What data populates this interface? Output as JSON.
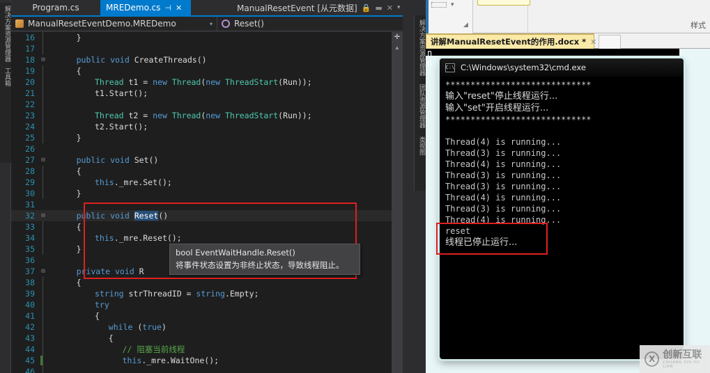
{
  "vs": {
    "dock_left_tabs": [
      "解决方案资源管理器",
      "工具箱"
    ],
    "dock_right_tabs": [
      "解决方案资源管理器",
      "团队资源管理器",
      "类视图"
    ],
    "tabs": [
      {
        "label": "Program.cs",
        "state": "inactive"
      },
      {
        "label": "MREDemo.cs",
        "state": "active",
        "pin": "⊣",
        "close": "✕"
      },
      {
        "label": "ManualResetEvent [从元数据]",
        "state": "metadata",
        "lock": "🔒",
        "close": "✕",
        "chevron": "▾"
      }
    ],
    "navbar": {
      "type_name": "ManualResetEventDemo.MREDemo",
      "member_name": "Reset()",
      "chevron": "▾"
    },
    "tooltip": {
      "signature": "bool EventWaitHandle.Reset()",
      "description": "将事件状态设置为非终止状态，导致线程阻止。"
    },
    "scrollbar": {
      "split_icon": "✛",
      "up_arrow": "▲"
    },
    "code_lines": [
      {
        "n": "16",
        "fold": "",
        "rail": true,
        "indent": 6,
        "segs": [
          {
            "t": "}",
            "c": "w"
          }
        ]
      },
      {
        "n": "17",
        "fold": "",
        "rail": true,
        "indent": 0,
        "segs": []
      },
      {
        "n": "18",
        "fold": "⊟",
        "rail": false,
        "indent": 6,
        "segs": [
          {
            "t": "public ",
            "c": "k"
          },
          {
            "t": "void ",
            "c": "k"
          },
          {
            "t": "CreateThreads()",
            "c": "w"
          }
        ]
      },
      {
        "n": "19",
        "fold": "",
        "rail": true,
        "indent": 6,
        "segs": [
          {
            "t": "{",
            "c": "w"
          }
        ]
      },
      {
        "n": "20",
        "fold": "",
        "rail": true,
        "indent": 10,
        "segs": [
          {
            "t": "Thread",
            "c": "t"
          },
          {
            "t": " t1 = ",
            "c": "w"
          },
          {
            "t": "new ",
            "c": "k"
          },
          {
            "t": "Thread",
            "c": "t"
          },
          {
            "t": "(",
            "c": "w"
          },
          {
            "t": "new ",
            "c": "k"
          },
          {
            "t": "ThreadStart",
            "c": "t"
          },
          {
            "t": "(Run));",
            "c": "w"
          }
        ]
      },
      {
        "n": "21",
        "fold": "",
        "rail": true,
        "indent": 10,
        "segs": [
          {
            "t": "t1.Start();",
            "c": "w"
          }
        ]
      },
      {
        "n": "22",
        "fold": "",
        "rail": true,
        "indent": 0,
        "segs": []
      },
      {
        "n": "23",
        "fold": "",
        "rail": true,
        "indent": 10,
        "segs": [
          {
            "t": "Thread",
            "c": "t"
          },
          {
            "t": " t2 = ",
            "c": "w"
          },
          {
            "t": "new ",
            "c": "k"
          },
          {
            "t": "Thread",
            "c": "t"
          },
          {
            "t": "(",
            "c": "w"
          },
          {
            "t": "new ",
            "c": "k"
          },
          {
            "t": "ThreadStart",
            "c": "t"
          },
          {
            "t": "(Run));",
            "c": "w"
          }
        ]
      },
      {
        "n": "24",
        "fold": "",
        "rail": true,
        "indent": 10,
        "segs": [
          {
            "t": "t2.Start();",
            "c": "w"
          }
        ]
      },
      {
        "n": "25",
        "fold": "",
        "rail": true,
        "indent": 6,
        "segs": [
          {
            "t": "}",
            "c": "w"
          }
        ]
      },
      {
        "n": "26",
        "fold": "",
        "rail": false,
        "indent": 0,
        "segs": []
      },
      {
        "n": "27",
        "fold": "⊟",
        "rail": false,
        "indent": 6,
        "segs": [
          {
            "t": "public ",
            "c": "k"
          },
          {
            "t": "void ",
            "c": "k"
          },
          {
            "t": "Set()",
            "c": "w"
          }
        ]
      },
      {
        "n": "28",
        "fold": "",
        "rail": true,
        "indent": 6,
        "segs": [
          {
            "t": "{",
            "c": "w"
          }
        ]
      },
      {
        "n": "29",
        "fold": "",
        "rail": true,
        "indent": 10,
        "segs": [
          {
            "t": "this",
            "c": "k"
          },
          {
            "t": "._mre.Set();",
            "c": "w"
          }
        ]
      },
      {
        "n": "30",
        "fold": "",
        "rail": true,
        "indent": 6,
        "segs": [
          {
            "t": "}",
            "c": "w"
          }
        ]
      },
      {
        "n": "31",
        "fold": "",
        "rail": false,
        "indent": 0,
        "segs": []
      },
      {
        "n": "32",
        "fold": "⊟",
        "rail": false,
        "indent": 6,
        "cur": true,
        "segs": [
          {
            "t": "public ",
            "c": "k"
          },
          {
            "t": "void ",
            "c": "k"
          },
          {
            "t": "Reset",
            "c": "sel"
          },
          {
            "t": "()",
            "c": "w"
          }
        ]
      },
      {
        "n": "33",
        "fold": "",
        "rail": true,
        "indent": 6,
        "segs": [
          {
            "t": "{",
            "c": "w"
          }
        ]
      },
      {
        "n": "34",
        "fold": "",
        "rail": true,
        "indent": 10,
        "segs": [
          {
            "t": "this",
            "c": "k"
          },
          {
            "t": "._mre.Reset();",
            "c": "w"
          }
        ]
      },
      {
        "n": "35",
        "fold": "",
        "rail": true,
        "indent": 6,
        "segs": [
          {
            "t": "}",
            "c": "w"
          }
        ]
      },
      {
        "n": "36",
        "fold": "",
        "rail": false,
        "indent": 0,
        "segs": []
      },
      {
        "n": "37",
        "fold": "⊟",
        "rail": false,
        "indent": 6,
        "segs": [
          {
            "t": "private ",
            "c": "k"
          },
          {
            "t": "void ",
            "c": "k"
          },
          {
            "t": "R",
            "c": "w"
          }
        ]
      },
      {
        "n": "38",
        "fold": "",
        "rail": true,
        "indent": 6,
        "segs": [
          {
            "t": "{",
            "c": "w"
          }
        ]
      },
      {
        "n": "39",
        "fold": "",
        "rail": true,
        "indent": 10,
        "segs": [
          {
            "t": "string",
            "c": "k"
          },
          {
            "t": " strThreadID = ",
            "c": "w"
          },
          {
            "t": "string",
            "c": "k"
          },
          {
            "t": ".Empty;",
            "c": "w"
          }
        ]
      },
      {
        "n": "40",
        "fold": "",
        "rail": true,
        "indent": 10,
        "segs": [
          {
            "t": "try",
            "c": "k"
          }
        ]
      },
      {
        "n": "41",
        "fold": "",
        "rail": true,
        "indent": 10,
        "segs": [
          {
            "t": "{",
            "c": "w"
          }
        ]
      },
      {
        "n": "42",
        "fold": "",
        "rail": true,
        "indent": 13,
        "segs": [
          {
            "t": "while ",
            "c": "k"
          },
          {
            "t": "(",
            "c": "w"
          },
          {
            "t": "true",
            "c": "k"
          },
          {
            "t": ")",
            "c": "w"
          }
        ]
      },
      {
        "n": "43",
        "fold": "",
        "rail": true,
        "indent": 13,
        "segs": [
          {
            "t": "{",
            "c": "w"
          }
        ]
      },
      {
        "n": "44",
        "fold": "",
        "rail": true,
        "indent": 16,
        "segs": [
          {
            "t": "// 阻塞当前线程",
            "c": "c"
          }
        ]
      },
      {
        "n": "45",
        "fold": "",
        "rail": true,
        "indent": 16,
        "caret": true,
        "segs": [
          {
            "t": "this",
            "c": "k"
          },
          {
            "t": "._mre.WaitOne();",
            "c": "w"
          }
        ]
      },
      {
        "n": "46",
        "fold": "",
        "rail": true,
        "indent": 0,
        "segs": []
      }
    ]
  },
  "word": {
    "styles_label": "样式",
    "doc_tab_label": "讲解ManualResetEvent的作用.docx *",
    "doc_tab_close": "✕",
    "edge_chars": {
      "line1": "n",
      "line2": "n"
    }
  },
  "cmd": {
    "title": "C:\\Windows\\system32\\cmd.exe",
    "icon_label": "C:\\",
    "lines": [
      {
        "text": "*****************************",
        "cn": false
      },
      {
        "text": "输入\"reset\"停止线程运行...",
        "cn": true
      },
      {
        "text": "输入\"set\"开启线程运行...",
        "cn": true
      },
      {
        "text": "*****************************",
        "cn": false
      },
      {
        "text": "",
        "cn": false
      },
      {
        "text": "Thread(4) is running...",
        "cn": false
      },
      {
        "text": "Thread(3) is running...",
        "cn": false
      },
      {
        "text": "Thread(4) is running...",
        "cn": false
      },
      {
        "text": "Thread(3) is running...",
        "cn": false
      },
      {
        "text": "Thread(3) is running...",
        "cn": false
      },
      {
        "text": "Thread(4) is running...",
        "cn": false
      },
      {
        "text": "Thread(3) is running...",
        "cn": false
      },
      {
        "text": "Thread(4) is running...",
        "cn": false
      },
      {
        "text": "reset",
        "cn": false
      },
      {
        "text": "线程已停止运行...",
        "cn": true
      }
    ]
  },
  "watermark": {
    "mark": "X",
    "cn": "创新互联",
    "en": "CHUANG XIN HU LIAN"
  },
  "colors": {
    "vs_accent": "#007acc",
    "annotation_red": "#e02020",
    "editor_bg": "#1e1e1e",
    "console_bg": "#000000"
  }
}
